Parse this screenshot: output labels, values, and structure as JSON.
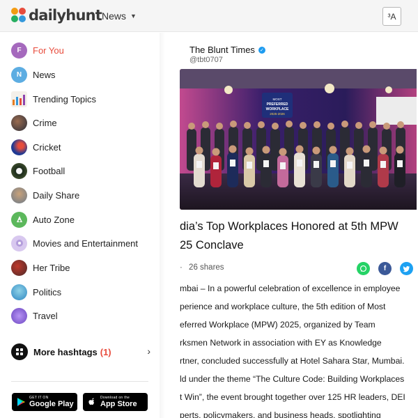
{
  "header": {
    "logo_text": "dailyhunt",
    "nav_menu_label": "News",
    "language_button_label": "³A"
  },
  "sidebar": {
    "items": [
      {
        "label": "For You",
        "icon": "for-you-icon",
        "initial": "F",
        "color": "#9b59b6",
        "active": true
      },
      {
        "label": "News",
        "icon": "news-icon",
        "initial": "N",
        "color": "#5dade2",
        "active": false
      },
      {
        "label": "Trending Topics",
        "icon": "trending-topics-icon",
        "active": false
      },
      {
        "label": "Crime",
        "icon": "crime-icon",
        "active": false
      },
      {
        "label": "Cricket",
        "icon": "cricket-icon",
        "active": false
      },
      {
        "label": "Football",
        "icon": "football-icon",
        "active": false
      },
      {
        "label": "Daily Share",
        "icon": "daily-share-icon",
        "active": false
      },
      {
        "label": "Auto Zone",
        "icon": "auto-zone-icon",
        "active": false
      },
      {
        "label": "Movies and Entertainment",
        "icon": "movies-icon",
        "active": false
      },
      {
        "label": "Her Tribe",
        "icon": "her-tribe-icon",
        "active": false
      },
      {
        "label": "Politics",
        "icon": "politics-icon",
        "active": false
      },
      {
        "label": "Travel",
        "icon": "travel-icon",
        "active": false
      }
    ],
    "more_hashtags": {
      "label": "More hashtags",
      "count": "(1)"
    },
    "app_badges": {
      "google_play": {
        "small": "GET IT ON",
        "big": "Google Play"
      },
      "app_store": {
        "small": "Download on the",
        "big": "App Store"
      }
    }
  },
  "article": {
    "publisher": "The Blunt Times",
    "handle": "@tbt0707",
    "headline_line1": "dia’s Top Workplaces Honored at 5th MPW",
    "headline_line2": "25 Conclave",
    "meta_prefix": "·",
    "shares": "26 shares",
    "body_lines": [
      "mbai – In a powerful celebration of excellence in employee",
      "perience and workplace culture, the 5th edition of Most",
      "eferred Workplace (MPW) 2025, organized by Team",
      "rksmen Network in association with EY as Knowledge",
      "rtner, concluded successfully at Hotel Sahara Star, Mumbai.",
      "ld under the theme “The Culture Code: Building Workplaces",
      "t Win”, the event brought together over 125 HR leaders, DEI",
      "perts, policymakers, and business heads, spotlighting"
    ],
    "banner_text": {
      "line1": "MOST",
      "line2": "PREFERRED",
      "line3": "WORKPLACE",
      "line4": "2025-2026"
    }
  },
  "colors": {
    "accent": "#e84c3d",
    "whatsapp": "#25d366",
    "facebook": "#3b5998",
    "twitter": "#1da1f2"
  }
}
